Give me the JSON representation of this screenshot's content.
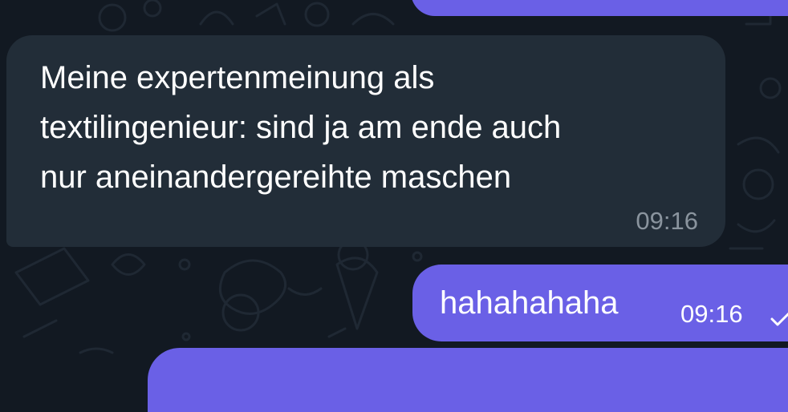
{
  "colors": {
    "background": "#121922",
    "incoming_bubble": "#222d38",
    "outgoing_bubble": "#6a60e6",
    "incoming_time": "#8a949e"
  },
  "messages": [
    {
      "direction": "incoming",
      "lines": [
        "Meine expertenmeinung als",
        "textilingenieur: sind ja am ende auch",
        "nur aneinandergereihte maschen"
      ],
      "time": "09:16"
    },
    {
      "direction": "outgoing",
      "text": "hahahahaha",
      "time": "09:16",
      "status_icon": "single-check-icon"
    }
  ]
}
